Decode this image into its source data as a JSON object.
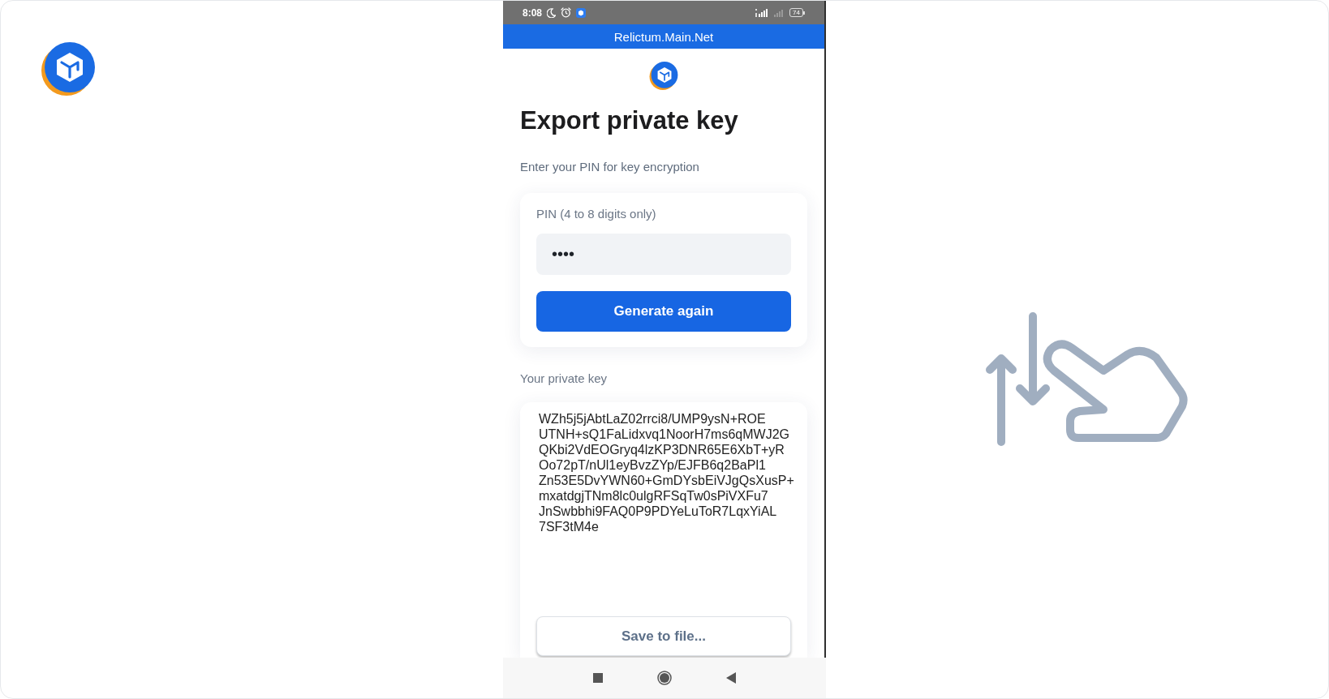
{
  "status_bar": {
    "time": "8:08",
    "battery": "74"
  },
  "header": {
    "title": "Relictum.Main.Net"
  },
  "page": {
    "title": "Export private key",
    "subtitle": "Enter your PIN for key encryption"
  },
  "pin_card": {
    "label": "PIN (4 to 8 digits only)",
    "value": "••••",
    "button": "Generate again"
  },
  "private_key": {
    "label": "Your private key",
    "lines": [
      "WZh5j5jAbtLaZ02rrci8/UMP9ysN+ROE",
      "UTNH+sQ1FaLidxvq1NoorH7ms6qMWJ2G",
      "QKbi2VdEOGryq4lzKP3DNR65E6XbT+yR",
      "Oo72pT/nUl1eyBvzZYp/EJFB6q2BaPl1",
      "Zn53E5DvYWN60+GmDYsbEiVJgQsXusP+",
      "mxatdgjTNm8lc0ulgRFSqTw0sPiVXFu7",
      "JnSwbbhi9FAQ0P9PDYeLuToR7LqxYiAL",
      "7SF3tM4e"
    ],
    "button": "Save to file..."
  }
}
